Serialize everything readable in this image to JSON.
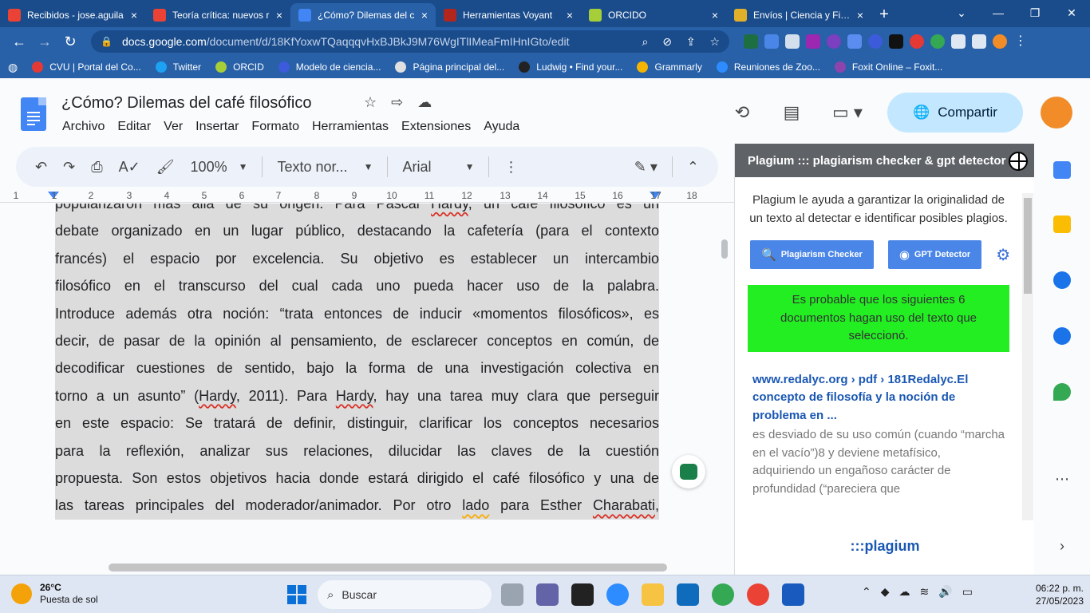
{
  "browser": {
    "tabs": [
      {
        "title": "Recibidos - jose.aguila",
        "icon": "gmail-icon",
        "color": "#ea4335",
        "active": false
      },
      {
        "title": "Teoría crítica: nuevos r",
        "icon": "gmail-icon",
        "color": "#ea4335",
        "active": false
      },
      {
        "title": "¿Cómo? Dilemas del c",
        "icon": "google-docs-icon",
        "color": "#4285f4",
        "active": true
      },
      {
        "title": "Herramientas Voyant",
        "icon": "voyant-icon",
        "color": "#b3261e",
        "active": false
      },
      {
        "title": "ORCIDO",
        "icon": "orcid-icon",
        "color": "#a6ce39",
        "active": false
      },
      {
        "title": "Envíos | Ciencia y Filos",
        "icon": "journal-icon",
        "color": "#e0b02a",
        "active": false
      }
    ],
    "new_tab": "+",
    "url_host": "docs.google.com",
    "url_path": "/document/d/18KfYoxwTQaqqqvHxBJBkJ9M76WgITlIMeaFmIHnIGto/edit",
    "bookmarks": [
      {
        "label": "CVU | Portal del Co...",
        "color": "#e53935"
      },
      {
        "label": "Twitter",
        "color": "#1da1f2"
      },
      {
        "label": "ORCID",
        "color": "#a6ce39"
      },
      {
        "label": "Modelo de ciencia...",
        "color": "#3b5bdb"
      },
      {
        "label": "Página principal del...",
        "color": "#e0e0e0"
      },
      {
        "label": "Ludwig • Find your...",
        "color": "#222222"
      },
      {
        "label": "Grammarly",
        "color": "#f4b400"
      },
      {
        "label": "Reuniones de Zoo...",
        "color": "#2d8cff"
      },
      {
        "label": "Foxit Online – Foxit...",
        "color": "#8e44ad"
      }
    ]
  },
  "docs": {
    "title": "¿Cómo? Dilemas del café filosófico",
    "menu": [
      "Archivo",
      "Editar",
      "Ver",
      "Insertar",
      "Formato",
      "Herramientas",
      "Extensiones",
      "Ayuda"
    ],
    "share_label": "Compartir",
    "toolbar": {
      "zoom": "100%",
      "style": "Texto nor...",
      "font": "Arial"
    },
    "ruler_numbers": [
      "1",
      "1",
      "2",
      "3",
      "4",
      "5",
      "6",
      "7",
      "8",
      "9",
      "10",
      "11",
      "12",
      "13",
      "14",
      "15",
      "16",
      "17",
      "18"
    ],
    "body_lines": [
      [
        "popularizaron más allá de su origen. Para Pascal ",
        {
          "sq": "Hardy"
        },
        ", un café filosófico es un"
      ],
      [
        "debate organizado en un lugar público, destacando la cafetería (para el contexto"
      ],
      [
        "francés) el espacio por excelencia. Su objetivo es establecer un intercambio"
      ],
      [
        "filosófico en el transcurso del cual cada uno pueda hacer uso de la palabra."
      ],
      [
        "Introduce además otra noción: “trata entonces de inducir «momentos filosóficos», es"
      ],
      [
        "decir, de pasar de la opinión al pensamiento, de esclarecer conceptos en común, de"
      ],
      [
        "decodificar cuestiones de sentido, bajo la forma de una investigación colectiva en"
      ],
      [
        "torno a un asunto” (",
        {
          "sq": "Hardy"
        },
        ", 2011). Para ",
        {
          "sq": "Hardy"
        },
        ", hay una tarea muy clara que perseguir"
      ],
      [
        "en este espacio: Se tratará de definir, distinguir, clarificar los conceptos necesarios"
      ],
      [
        "para la reflexión, analizar sus relaciones, dilucidar las claves de la cuestión"
      ],
      [
        "propuesta. Son estos objetivos hacia donde estará dirigido el café filosófico y una de"
      ],
      [
        "las tareas principales del moderador/animador. Por otro ",
        {
          "sqy": "lado"
        },
        " para  Esther ",
        {
          "sq": "Charabati"
        },
        ","
      ]
    ]
  },
  "plagium": {
    "header": "Plagium ::: plagiarism checker & gpt detector",
    "intro": "Plagium le ayuda a garantizar la originalidad de un texto al detectar e identificar posibles plagios.",
    "btn_plagiarism": "Plagiarism Checker",
    "btn_gpt": "GPT Detector",
    "alert": "Es probable que los siguientes 6 documentos hagan uso del texto que seleccionó.",
    "result_title": "www.redalyc.org › pdf › 181Redalyc.El concepto de filosofía y la noción de problema en ...",
    "result_snippet": "es desviado de su uso común (cuando “marcha en el vacío”)8 y deviene metafísico, adquiriendo un engañoso carácter de profundidad (“pareciera que",
    "logo": ":::plagium"
  },
  "taskbar": {
    "temp": "26°C",
    "weather": "Puesta de sol",
    "search": "Buscar",
    "time": "06:22 p. m.",
    "date": "27/05/2023"
  }
}
